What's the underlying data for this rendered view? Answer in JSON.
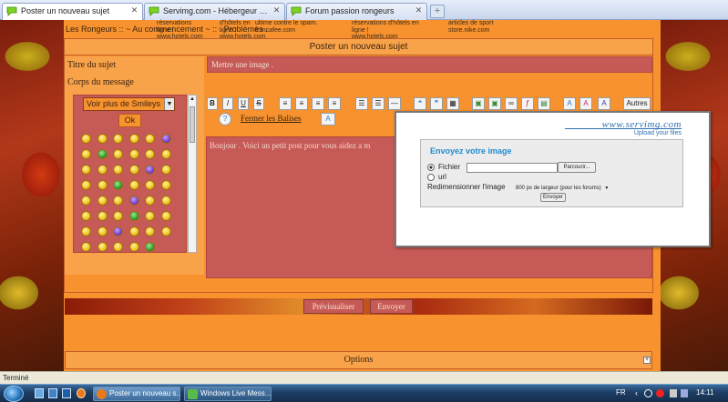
{
  "browser": {
    "tabs": [
      {
        "label": "Poster un nouveau sujet",
        "active": true,
        "icon": "forum-icon"
      },
      {
        "label": "Servimg.com - Hébergeur gratuit d'...",
        "active": false,
        "icon": "forum-icon"
      },
      {
        "label": "Forum passion rongeurs",
        "active": false,
        "icon": "forum-icon"
      }
    ],
    "new_tab_label": "+"
  },
  "ads": {
    "snippet1": "réservations\nligne !\nwww.hotels.com",
    "snippet2": "d'hôtels en\nligne !\nwww.hotels.com",
    "snippet3": "ultime contre le spam.\nfr.mcafee.com",
    "snippet4": "réservations d'hôtels en\nligne !\nwww.hotels.com",
    "snippet5": "articles de sport\nstore.nike.com"
  },
  "breadcrumb": "Les Rongeurs   :: ~ Au commencement ~ :: . Problèmes .",
  "form": {
    "title": "Poster un nouveau sujet",
    "subject_label": "Titre du sujet",
    "subject_value": "Mettre une image .",
    "message_label": "Corps du message",
    "smiley_select": "Voir plus de Smileys",
    "ok_label": "Ok",
    "message_value": "Bonjour . Voici un petit post pour vous aidez a m",
    "close_tags": "Fermer les Balises",
    "more_label": "Autres",
    "toolbar": {
      "bold": "B",
      "italic": "I",
      "underline": "U",
      "strike": "S"
    },
    "preview_label": "Prévisualiser",
    "send_label": "Envoyer",
    "options_label": "Options",
    "options_expand": "+"
  },
  "popup": {
    "logo_text": "www.servimg.com",
    "tagline": "Upload your files",
    "heading": "Envoyez votre image",
    "file_label": "Fichier",
    "browse_label": "Parcourir...",
    "url_label": "url",
    "resize_label": "Redimensionner l'image",
    "resize_value": "800 px de largeur (pour les forums)",
    "submit_label": "Envoyer"
  },
  "status": {
    "text": "Terminé"
  },
  "taskbar": {
    "items": [
      {
        "label": "Poster un nouveau s..."
      },
      {
        "label": "Windows Live Mess..."
      }
    ],
    "lang": "FR",
    "clock": "14:11"
  },
  "colors": {
    "page": "#f7922e",
    "field": "#c65a56",
    "accent": "#1f8ad0"
  }
}
